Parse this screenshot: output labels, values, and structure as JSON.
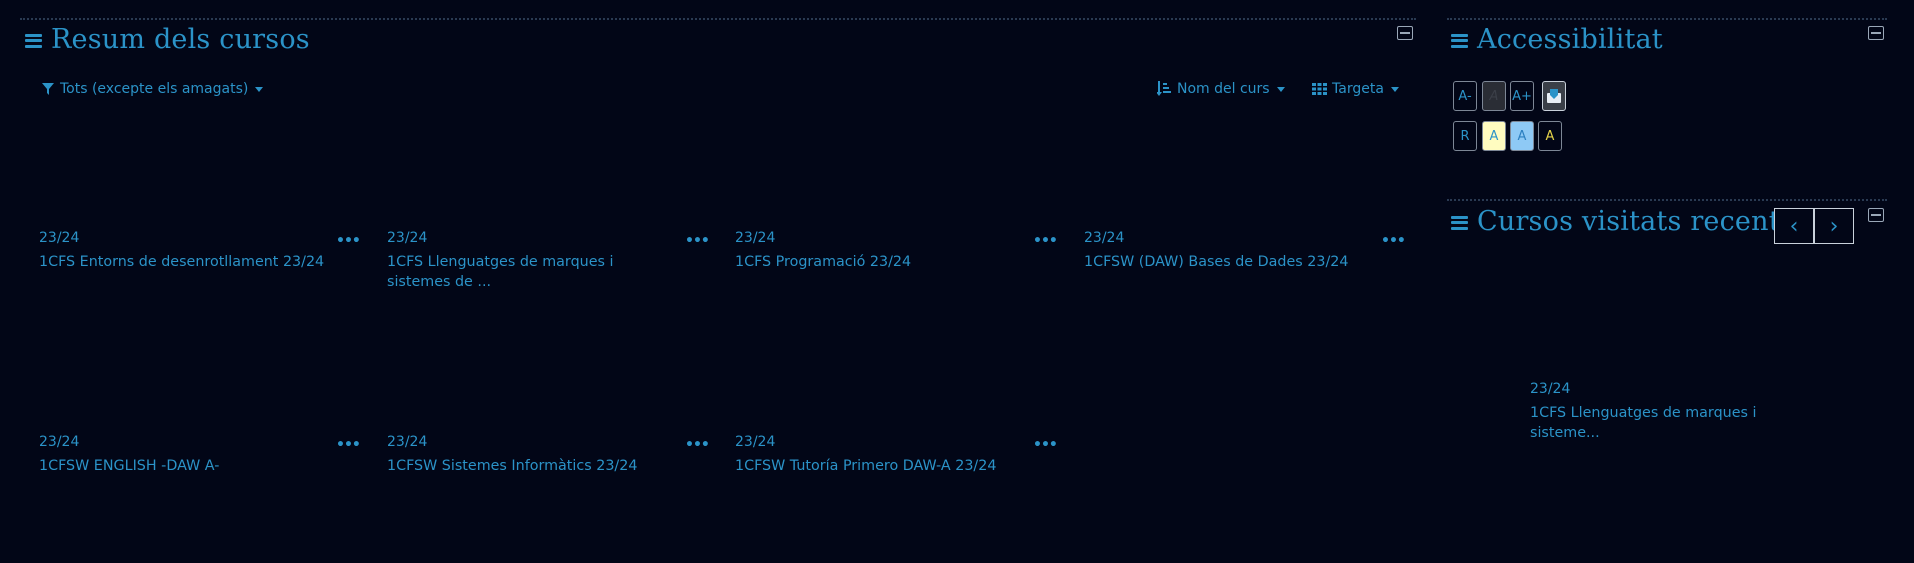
{
  "summary": {
    "title": "Resum dels cursos",
    "filter_label": "Tots (excepte els amagats)",
    "sort_label": "Nom del curs",
    "view_label": "Targeta",
    "more_glyph": "•••",
    "courses": [
      {
        "term": "23/24",
        "name": "1CFS Entorns de desenrotllament 23/24"
      },
      {
        "term": "23/24",
        "name": "1CFS Llenguatges de marques i sistemes de ..."
      },
      {
        "term": "23/24",
        "name": "1CFS Programació 23/24"
      },
      {
        "term": "23/24",
        "name": "1CFSW (DAW) Bases de Dades 23/24"
      },
      {
        "term": "23/24",
        "name": "1CFSW ENGLISH -DAW A-"
      },
      {
        "term": "23/24",
        "name": "1CFSW Sistemes Informàtics 23/24"
      },
      {
        "term": "23/24",
        "name": "1CFSW Tutoría Primero DAW-A 23/24"
      }
    ]
  },
  "accessibility": {
    "title": "Accessibilitat",
    "buttons_row1": [
      "A-",
      "A",
      "A+"
    ],
    "buttons_row2": [
      "R",
      "A",
      "A",
      "A"
    ],
    "colors": {
      "bg_yellow": "#fffcc0",
      "bg_blue": "#8ec9f5",
      "text_yellow": "#e6d44a"
    }
  },
  "recent": {
    "title": "Cursos visitats recentment",
    "prev_label": "‹",
    "next_label": "›",
    "course": {
      "term": "23/24",
      "name": "1CFS Llenguatges de marques i sisteme..."
    }
  },
  "colors": {
    "background": "#020617",
    "accent": "#2b93c8"
  }
}
